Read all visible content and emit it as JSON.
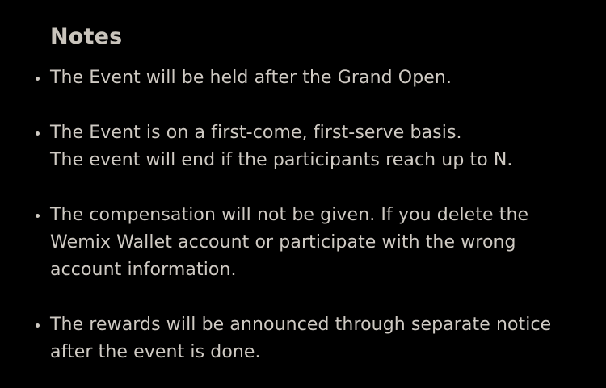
{
  "notes": {
    "title": "Notes",
    "items": [
      {
        "lines": [
          "The Event will be held after the Grand Open."
        ]
      },
      {
        "lines": [
          "The Event is on a first-come, first-serve basis.",
          "The event will end if the participants reach up to N."
        ]
      },
      {
        "lines": [
          "The compensation will not be given. If you delete the",
          "Wemix Wallet account or participate with the wrong",
          "account information."
        ]
      },
      {
        "lines": [
          "The rewards will be announced through separate notice",
          "after the event is done."
        ]
      }
    ]
  },
  "colors": {
    "background": "#000000",
    "text": "#cfcac3",
    "title": "#c9c4bc"
  }
}
